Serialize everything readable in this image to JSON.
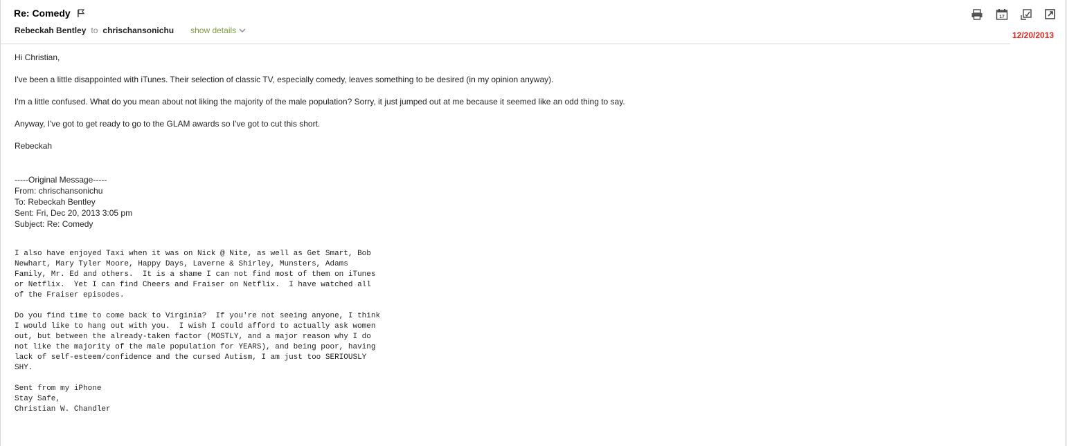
{
  "email": {
    "subject": "Re: Comedy",
    "sender": "Rebeckah Bentley",
    "to_word": "to",
    "recipient": "chrischansonichu",
    "show_details": "show details",
    "date_stamp": "12/20/2013"
  },
  "toolbar": {
    "icons": [
      "print-icon",
      "calendar-icon",
      "report-icon",
      "new-window-icon"
    ],
    "calendar_day": "17"
  },
  "body": {
    "greeting": "Hi Christian,",
    "paragraphs": [
      "I've been a little disappointed with iTunes. Their selection of classic TV, especially comedy, leaves something to be desired (in my opinion anyway).",
      "I'm a little confused. What do you mean about not liking the majority of the male population? Sorry, it just jumped out at me because it seemed like an odd thing to say.",
      "Anyway, I've got to get ready to go to the GLAM awards so I've got to cut this short."
    ],
    "signature": "Rebeckah"
  },
  "original": {
    "separator": "-----Original Message-----",
    "from": "From: chrischansonichu",
    "to": "To: Rebeckah Bentley",
    "sent": "Sent: Fri, Dec 20, 2013 3:05 pm",
    "subject": "Subject: Re: Comedy",
    "message_lines": [
      "I also have enjoyed Taxi when it was on Nick @ Nite, as well as Get Smart, Bob",
      "Newhart, Mary Tyler Moore, Happy Days, Laverne & Shirley, Munsters, Adams",
      "Family, Mr. Ed and others.  It is a shame I can not find most of them on iTunes",
      "or Netflix.  Yet I can find Cheers and Fraiser on Netflix.  I have watched all",
      "of the Fraiser episodes.",
      "",
      "Do you find time to come back to Virginia?  If you're not seeing anyone, I think",
      "I would like to hang out with you.  I wish I could afford to actually ask women",
      "out, but between the already-taken factor (MOSTLY, and a major reason why I do",
      "not like the majority of the male population for YEARS), and being poor, having",
      "lack of self-esteem/confidence and the cursed Autism, I am just too SERIOUSLY",
      "SHY.",
      "",
      "Sent from my iPhone",
      "Stay Safe,",
      "Christian W. Chandler"
    ]
  },
  "colors": {
    "show_details": "#7a9c3c",
    "date_stamp": "#e5271e",
    "rule": "#d8d8d8"
  }
}
